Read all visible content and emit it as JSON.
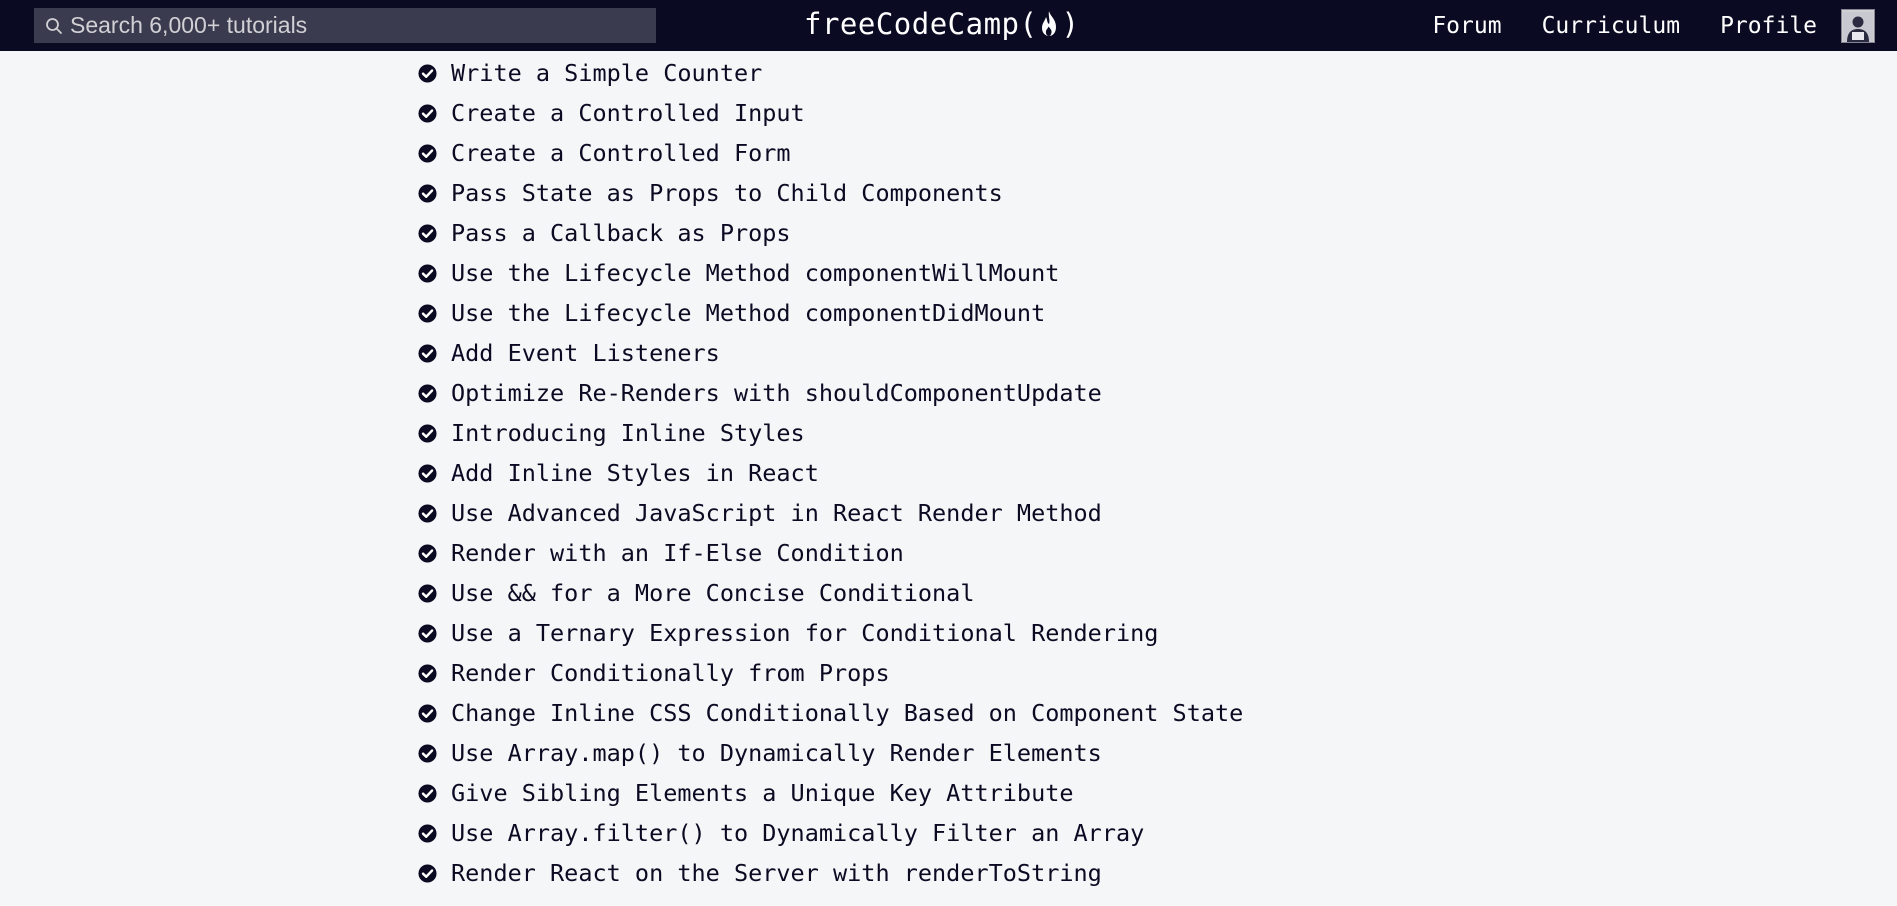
{
  "navbar": {
    "search": {
      "placeholder": "Search 6,000+ tutorials",
      "value": ""
    },
    "logo": {
      "text_before": "freeCodeCamp(",
      "text_after": ")"
    },
    "links": [
      {
        "label": "Forum"
      },
      {
        "label": "Curriculum"
      },
      {
        "label": "Profile"
      }
    ]
  },
  "challenges": [
    {
      "title": "Write a Simple Counter",
      "completed": true
    },
    {
      "title": "Create a Controlled Input",
      "completed": true
    },
    {
      "title": "Create a Controlled Form",
      "completed": true
    },
    {
      "title": "Pass State as Props to Child Components",
      "completed": true
    },
    {
      "title": "Pass a Callback as Props",
      "completed": true
    },
    {
      "title": "Use the Lifecycle Method componentWillMount",
      "completed": true
    },
    {
      "title": "Use the Lifecycle Method componentDidMount",
      "completed": true
    },
    {
      "title": "Add Event Listeners",
      "completed": true
    },
    {
      "title": "Optimize Re-Renders with shouldComponentUpdate",
      "completed": true
    },
    {
      "title": "Introducing Inline Styles",
      "completed": true
    },
    {
      "title": "Add Inline Styles in React",
      "completed": true
    },
    {
      "title": "Use Advanced JavaScript in React Render Method",
      "completed": true
    },
    {
      "title": "Render with an If-Else Condition",
      "completed": true
    },
    {
      "title": "Use && for a More Concise Conditional",
      "completed": true
    },
    {
      "title": "Use a Ternary Expression for Conditional Rendering",
      "completed": true
    },
    {
      "title": "Render Conditionally from Props",
      "completed": true
    },
    {
      "title": "Change Inline CSS Conditionally Based on Component State",
      "completed": true
    },
    {
      "title": "Use Array.map() to Dynamically Render Elements",
      "completed": true
    },
    {
      "title": "Give Sibling Elements a Unique Key Attribute",
      "completed": true
    },
    {
      "title": "Use Array.filter() to Dynamically Filter an Array",
      "completed": true
    },
    {
      "title": "Render React on the Server with renderToString",
      "completed": true
    }
  ],
  "icons": {
    "search": "search-icon",
    "flame": "flame-icon",
    "check": "check-circle-icon",
    "avatar": "avatar-icon"
  },
  "colors": {
    "navbar_bg": "#0a0a23",
    "search_bg": "#3b3b4f",
    "page_bg": "#f5f6f7",
    "text": "#0a0a23"
  }
}
